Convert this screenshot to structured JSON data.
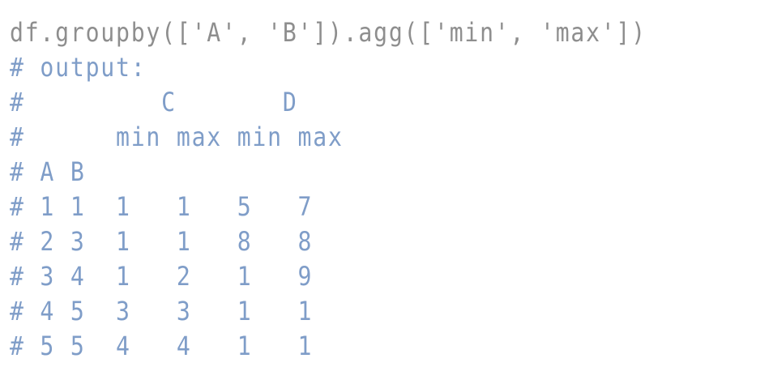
{
  "command": "df.groupby(['A', 'B']).agg(['min', 'max'])",
  "comments": [
    "# output:",
    "#         C       D",
    "#      min max min max",
    "# A B",
    "# 1 1  1   1   5   7",
    "# 2 3  1   1   8   8",
    "# 3 4  1   2   1   9",
    "# 4 5  3   3   1   1",
    "# 5 5  4   4   1   1"
  ],
  "colors": {
    "command": "#8e8e8e",
    "comment": "#7f9dc8",
    "background": "#ffffff"
  }
}
